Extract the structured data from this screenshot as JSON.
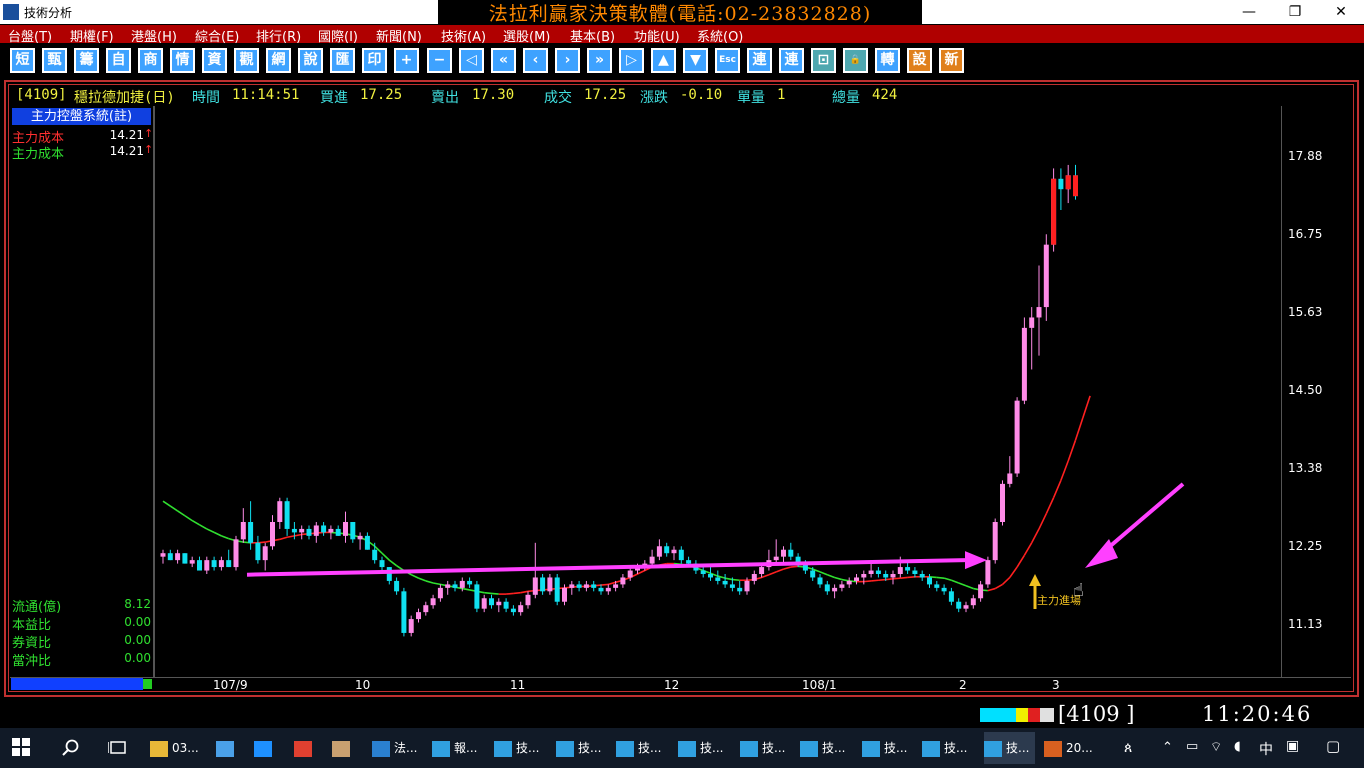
{
  "window": {
    "title": "技術分析",
    "banner": "法拉利贏家決策軟體(電話:02-23832828)",
    "minimize": "—",
    "maximize": "❐",
    "close": "✕"
  },
  "menu": [
    "台盤(T)",
    "期權(F)",
    "港盤(H)",
    "綜合(E)",
    "排行(R)",
    "國際(I)",
    "新聞(N)",
    "技術(A)",
    "選股(M)",
    "基本(B)",
    "功能(U)",
    "系統(O)"
  ],
  "toolbar": [
    "短",
    "甄",
    "籌",
    "自",
    "商",
    "情",
    "資",
    "觀",
    "網",
    "說",
    "匯",
    "印",
    "+",
    "−",
    "◁",
    "«",
    "‹",
    "›",
    "»",
    "▷",
    "▲",
    "▼",
    "Esc",
    "連",
    "連",
    "⊡",
    "🔒",
    "轉",
    "設",
    "新"
  ],
  "quote": {
    "code": "[4109]",
    "name": "穩拉德加捷(日)",
    "time_label": "時間",
    "time": "11:14:51",
    "bid_label": "買進",
    "bid": "17.25",
    "ask_label": "賣出",
    "ask": "17.30",
    "deal_label": "成交",
    "deal": "17.25",
    "change_label": "漲跌",
    "change": "-0.10",
    "vol_label": "單量",
    "vol": "1",
    "total_label": "總量",
    "total": "424"
  },
  "indicator": {
    "title": "主力控盤系統(註)",
    "rows": [
      {
        "label": "主力成本",
        "value": "14.21",
        "color": "#ff3030"
      },
      {
        "label": "主力成本",
        "value": "14.21",
        "color": "#30e030"
      }
    ],
    "stats": [
      {
        "label": "流通(億)",
        "value": "8.12"
      },
      {
        "label": "本益比",
        "value": "0.00"
      },
      {
        "label": "券資比",
        "value": "0.00"
      },
      {
        "label": "當沖比",
        "value": "0.00"
      }
    ]
  },
  "annotation": {
    "entry_label": "主力進場"
  },
  "chart_data": {
    "type": "candlestick",
    "y_ticks": [
      "17.88",
      "16.75",
      "15.63",
      "14.50",
      "13.38",
      "12.25",
      "11.13"
    ],
    "ylim": [
      10.35,
      18.6
    ],
    "x_ticks": [
      "107/9",
      "10",
      "11",
      "12",
      "108/1",
      "2",
      "3"
    ],
    "candles": [
      [
        12.1,
        12.2,
        12.0,
        12.15
      ],
      [
        12.15,
        12.2,
        12.05,
        12.05
      ],
      [
        12.05,
        12.2,
        12.0,
        12.15
      ],
      [
        12.15,
        12.15,
        12.0,
        12.0
      ],
      [
        12.0,
        12.1,
        11.95,
        12.05
      ],
      [
        12.05,
        12.1,
        11.9,
        11.9
      ],
      [
        11.9,
        12.1,
        11.85,
        12.05
      ],
      [
        12.05,
        12.1,
        11.9,
        11.95
      ],
      [
        11.95,
        12.1,
        11.9,
        12.05
      ],
      [
        12.05,
        12.2,
        11.95,
        11.95
      ],
      [
        11.95,
        12.4,
        11.9,
        12.35
      ],
      [
        12.35,
        12.8,
        12.3,
        12.6
      ],
      [
        12.6,
        12.9,
        12.2,
        12.3
      ],
      [
        12.3,
        12.4,
        12.0,
        12.05
      ],
      [
        12.05,
        12.3,
        11.9,
        12.25
      ],
      [
        12.25,
        12.7,
        12.2,
        12.6
      ],
      [
        12.6,
        12.95,
        12.5,
        12.9
      ],
      [
        12.9,
        12.95,
        12.4,
        12.5
      ],
      [
        12.5,
        12.6,
        12.35,
        12.45
      ],
      [
        12.45,
        12.55,
        12.35,
        12.5
      ],
      [
        12.5,
        12.55,
        12.35,
        12.4
      ],
      [
        12.4,
        12.6,
        12.3,
        12.55
      ],
      [
        12.55,
        12.6,
        12.4,
        12.45
      ],
      [
        12.45,
        12.55,
        12.35,
        12.5
      ],
      [
        12.5,
        12.55,
        12.4,
        12.4
      ],
      [
        12.4,
        12.75,
        12.3,
        12.6
      ],
      [
        12.6,
        12.6,
        12.3,
        12.35
      ],
      [
        12.35,
        12.45,
        12.2,
        12.4
      ],
      [
        12.4,
        12.45,
        12.2,
        12.2
      ],
      [
        12.2,
        12.3,
        12.0,
        12.05
      ],
      [
        12.05,
        12.1,
        11.9,
        11.95
      ],
      [
        11.95,
        11.95,
        11.7,
        11.75
      ],
      [
        11.75,
        11.8,
        11.55,
        11.6
      ],
      [
        11.6,
        11.65,
        10.95,
        11.0
      ],
      [
        11.0,
        11.25,
        10.95,
        11.2
      ],
      [
        11.2,
        11.35,
        11.15,
        11.3
      ],
      [
        11.3,
        11.45,
        11.25,
        11.4
      ],
      [
        11.4,
        11.55,
        11.35,
        11.5
      ],
      [
        11.5,
        11.7,
        11.45,
        11.65
      ],
      [
        11.65,
        11.75,
        11.55,
        11.7
      ],
      [
        11.7,
        11.75,
        11.6,
        11.65
      ],
      [
        11.65,
        11.8,
        11.6,
        11.75
      ],
      [
        11.75,
        11.8,
        11.65,
        11.7
      ],
      [
        11.7,
        11.75,
        11.3,
        11.35
      ],
      [
        11.35,
        11.55,
        11.3,
        11.5
      ],
      [
        11.5,
        11.55,
        11.35,
        11.4
      ],
      [
        11.4,
        11.5,
        11.3,
        11.45
      ],
      [
        11.45,
        11.5,
        11.3,
        11.35
      ],
      [
        11.35,
        11.4,
        11.25,
        11.3
      ],
      [
        11.3,
        11.45,
        11.25,
        11.4
      ],
      [
        11.4,
        11.6,
        11.35,
        11.55
      ],
      [
        11.55,
        12.3,
        11.5,
        11.8
      ],
      [
        11.8,
        11.85,
        11.55,
        11.6
      ],
      [
        11.6,
        11.85,
        11.55,
        11.8
      ],
      [
        11.8,
        11.85,
        11.4,
        11.45
      ],
      [
        11.45,
        11.7,
        11.4,
        11.65
      ],
      [
        11.65,
        11.75,
        11.55,
        11.7
      ],
      [
        11.7,
        11.75,
        11.6,
        11.65
      ],
      [
        11.65,
        11.75,
        11.6,
        11.7
      ],
      [
        11.7,
        11.75,
        11.6,
        11.65
      ],
      [
        11.65,
        11.7,
        11.55,
        11.6
      ],
      [
        11.6,
        11.7,
        11.55,
        11.65
      ],
      [
        11.65,
        11.75,
        11.6,
        11.7
      ],
      [
        11.7,
        11.85,
        11.65,
        11.8
      ],
      [
        11.8,
        11.95,
        11.75,
        11.9
      ],
      [
        11.9,
        12.0,
        11.85,
        11.95
      ],
      [
        11.95,
        12.05,
        11.9,
        12.0
      ],
      [
        12.0,
        12.2,
        11.95,
        12.1
      ],
      [
        12.1,
        12.35,
        12.05,
        12.25
      ],
      [
        12.25,
        12.3,
        12.1,
        12.15
      ],
      [
        12.15,
        12.25,
        12.05,
        12.2
      ],
      [
        12.2,
        12.25,
        12.0,
        12.05
      ],
      [
        12.05,
        12.1,
        11.95,
        12.0
      ],
      [
        12.0,
        12.05,
        11.85,
        11.9
      ],
      [
        11.9,
        11.95,
        11.8,
        11.85
      ],
      [
        11.85,
        11.95,
        11.75,
        11.8
      ],
      [
        11.8,
        11.9,
        11.7,
        11.75
      ],
      [
        11.75,
        11.85,
        11.65,
        11.7
      ],
      [
        11.7,
        11.8,
        11.6,
        11.65
      ],
      [
        11.65,
        11.75,
        11.55,
        11.6
      ],
      [
        11.6,
        11.8,
        11.55,
        11.75
      ],
      [
        11.75,
        11.9,
        11.7,
        11.85
      ],
      [
        11.85,
        12.0,
        11.8,
        11.95
      ],
      [
        11.95,
        12.2,
        11.9,
        12.05
      ],
      [
        12.05,
        12.35,
        12.0,
        12.1
      ],
      [
        12.1,
        12.25,
        12.0,
        12.2
      ],
      [
        12.2,
        12.3,
        12.05,
        12.1
      ],
      [
        12.1,
        12.15,
        11.95,
        12.0
      ],
      [
        12.0,
        12.05,
        11.85,
        11.9
      ],
      [
        11.9,
        11.95,
        11.75,
        11.8
      ],
      [
        11.8,
        11.85,
        11.65,
        11.7
      ],
      [
        11.7,
        11.75,
        11.55,
        11.6
      ],
      [
        11.6,
        11.7,
        11.5,
        11.65
      ],
      [
        11.65,
        11.75,
        11.6,
        11.7
      ],
      [
        11.7,
        11.8,
        11.65,
        11.75
      ],
      [
        11.75,
        11.85,
        11.7,
        11.8
      ],
      [
        11.8,
        11.9,
        11.7,
        11.85
      ],
      [
        11.85,
        12.0,
        11.8,
        11.9
      ],
      [
        11.9,
        11.95,
        11.8,
        11.85
      ],
      [
        11.85,
        11.9,
        11.75,
        11.8
      ],
      [
        11.8,
        11.9,
        11.7,
        11.85
      ],
      [
        11.85,
        12.1,
        11.8,
        11.95
      ],
      [
        11.95,
        12.05,
        11.85,
        11.9
      ],
      [
        11.9,
        11.95,
        11.8,
        11.85
      ],
      [
        11.85,
        11.9,
        11.75,
        11.8
      ],
      [
        11.8,
        11.85,
        11.65,
        11.7
      ],
      [
        11.7,
        11.75,
        11.6,
        11.65
      ],
      [
        11.65,
        11.7,
        11.55,
        11.6
      ],
      [
        11.6,
        11.65,
        11.4,
        11.45
      ],
      [
        11.45,
        11.5,
        11.3,
        11.35
      ],
      [
        11.35,
        11.45,
        11.3,
        11.4
      ],
      [
        11.4,
        11.55,
        11.35,
        11.5
      ],
      [
        11.5,
        11.75,
        11.45,
        11.7
      ],
      [
        11.7,
        12.1,
        11.65,
        12.05
      ],
      [
        12.05,
        12.65,
        12.0,
        12.6
      ],
      [
        12.6,
        13.2,
        12.55,
        13.15
      ],
      [
        13.15,
        13.55,
        13.1,
        13.3
      ],
      [
        13.3,
        14.4,
        13.25,
        14.35
      ],
      [
        14.35,
        15.55,
        14.3,
        15.4
      ],
      [
        15.4,
        15.7,
        14.8,
        15.55
      ],
      [
        15.55,
        16.3,
        15.0,
        15.7
      ],
      [
        15.7,
        16.75,
        15.5,
        16.6
      ],
      [
        16.6,
        17.7,
        16.5,
        17.55
      ],
      [
        17.55,
        17.7,
        17.1,
        17.4
      ],
      [
        17.4,
        17.75,
        17.2,
        17.6
      ],
      [
        17.6,
        17.75,
        17.25,
        17.3
      ]
    ],
    "cost_line": [
      12.9,
      12.83,
      12.76,
      12.69,
      12.62,
      12.56,
      12.5,
      12.45,
      12.4,
      12.36,
      12.33,
      12.31,
      12.3,
      12.3,
      12.31,
      12.33,
      12.35,
      12.38,
      12.4,
      12.42,
      12.43,
      12.44,
      12.45,
      12.45,
      12.44,
      12.43,
      12.41,
      12.38,
      12.33,
      12.25,
      12.15,
      12.05,
      11.97,
      11.9,
      11.84,
      11.79,
      11.75,
      11.72,
      11.7,
      11.68,
      11.66,
      11.64,
      11.62,
      11.6,
      11.58,
      11.57,
      11.56,
      11.56,
      11.57,
      11.58,
      11.6,
      11.61,
      11.62,
      11.63,
      11.64,
      11.65,
      11.66,
      11.67,
      11.67,
      11.68,
      11.69,
      11.7,
      11.73,
      11.76,
      11.8,
      11.85,
      11.9,
      11.95,
      11.98,
      12.0,
      12.0,
      11.99,
      11.97,
      11.94,
      11.9,
      11.86,
      11.82,
      11.79,
      11.77,
      11.76,
      11.76,
      11.77,
      11.8,
      11.84,
      11.88,
      11.92,
      11.95,
      11.96,
      11.95,
      11.92,
      11.88,
      11.84,
      11.8,
      11.77,
      11.75,
      11.74,
      11.74,
      11.75,
      11.76,
      11.77,
      11.78,
      11.79,
      11.8,
      11.81,
      11.81,
      11.81,
      11.8,
      11.79,
      11.76,
      11.72,
      11.68,
      11.64,
      11.62,
      11.61,
      11.64,
      11.7,
      11.8,
      11.95,
      12.12,
      12.3,
      12.5,
      12.72,
      12.95,
      13.2,
      13.48,
      13.78,
      14.1,
      14.42
    ],
    "trend_line": [
      11.84,
      12.05
    ],
    "colors": {
      "up": "#ff8ce8",
      "down": "#10e0f0",
      "cost_up": "#ff2020",
      "cost_down": "#30e030",
      "arrow": "#ff40ff",
      "rise_red": "#ff2020"
    }
  },
  "status": {
    "code": "[4109    ]",
    "time": "11:20:46"
  },
  "taskbar": [
    "03...",
    "",
    "",
    "",
    "",
    "法...",
    "報...",
    "技...",
    "技...",
    "技...",
    "技...",
    "技...",
    "技...",
    "技...",
    "技...",
    "技...",
    "20..."
  ],
  "tray": {
    "lang": "中"
  }
}
